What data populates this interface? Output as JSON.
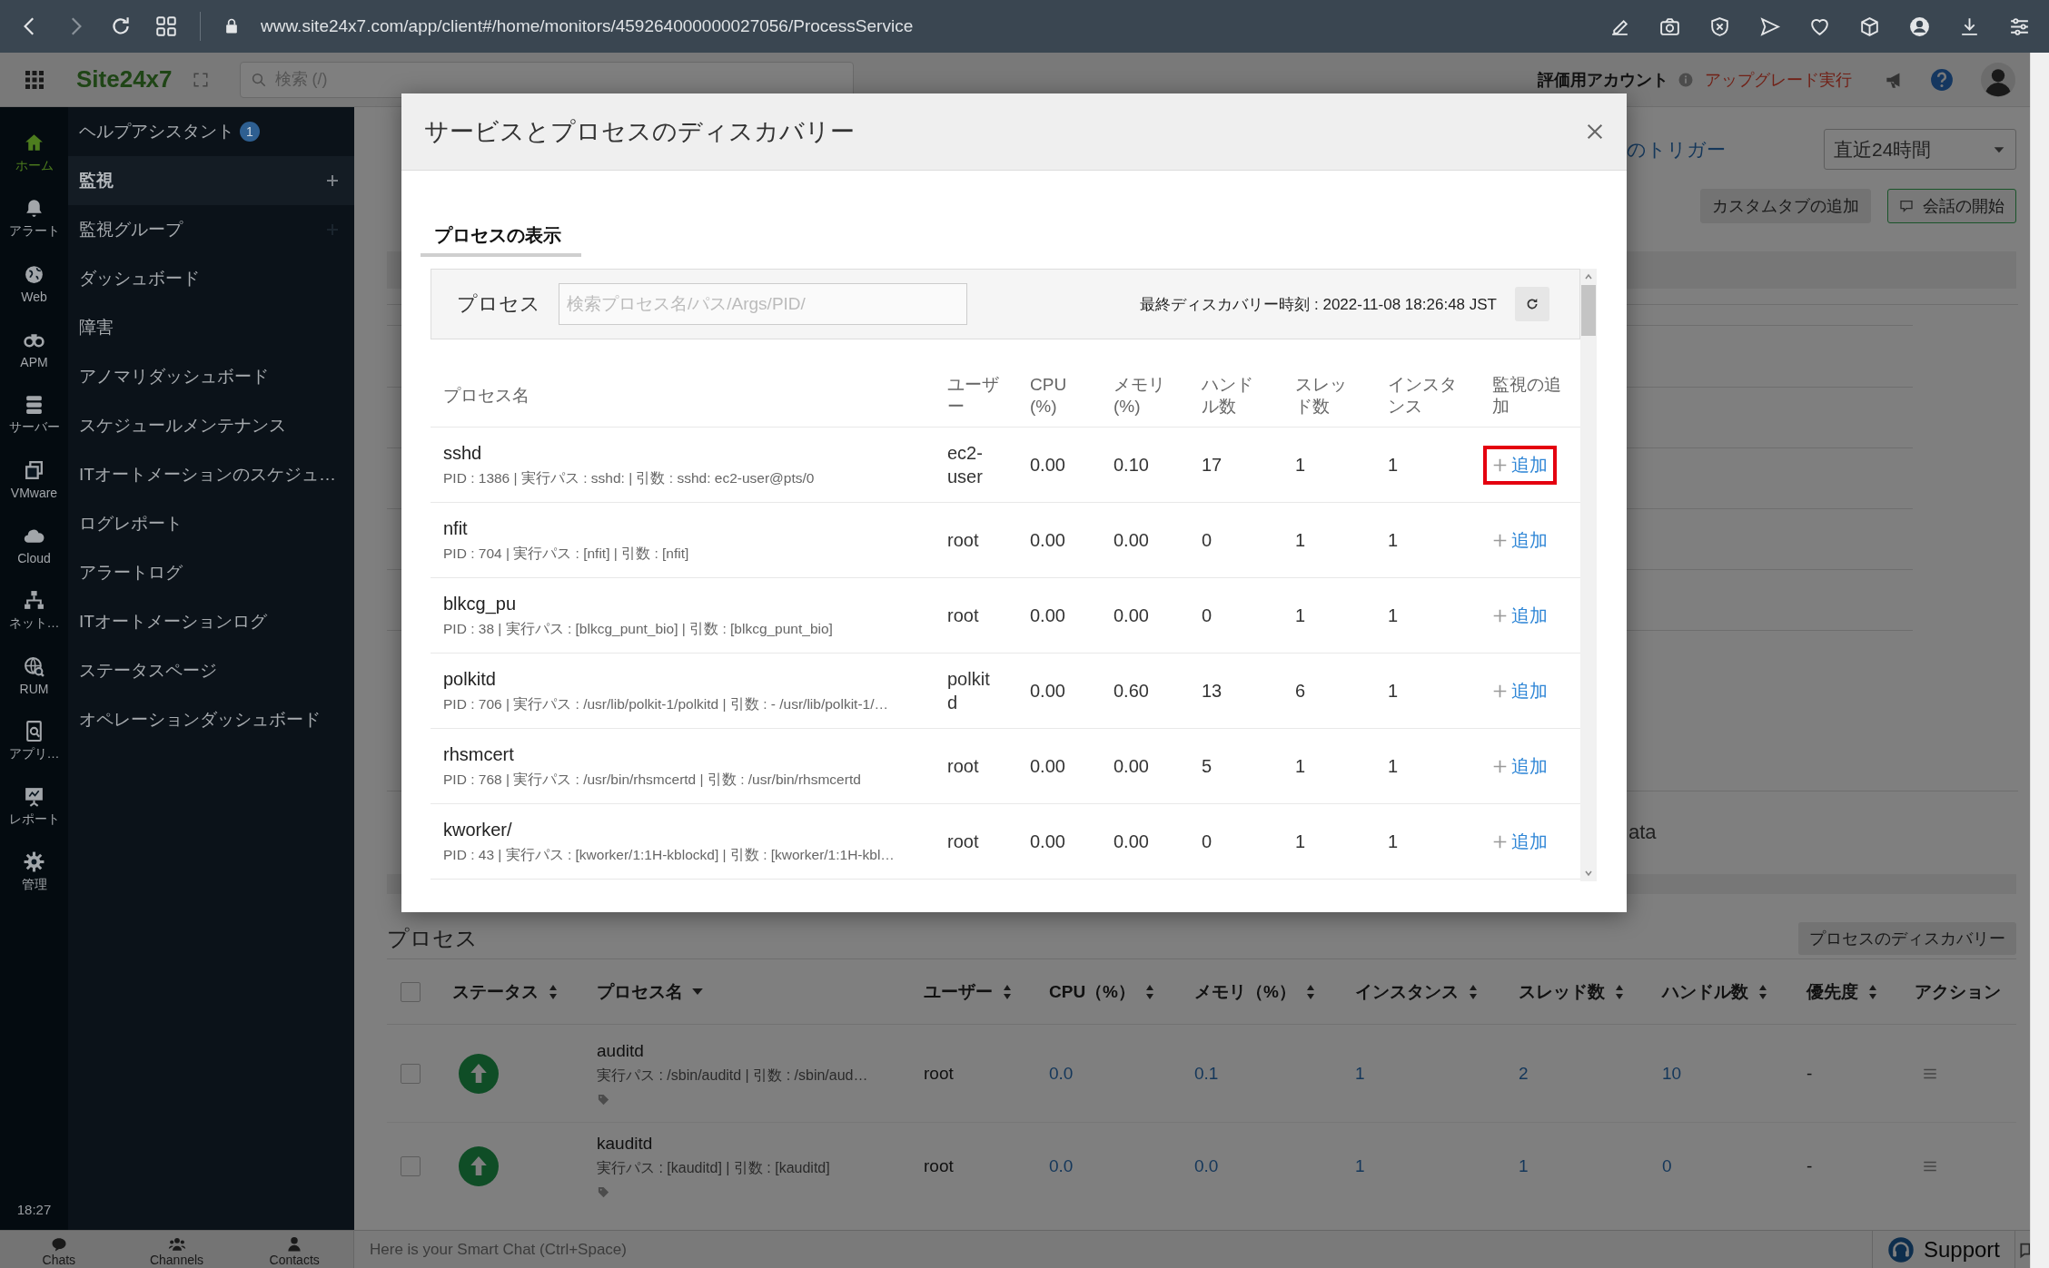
{
  "browser": {
    "url": "www.site24x7.com/app/client#/home/monitors/459264000000027056/ProcessService"
  },
  "header": {
    "logo": "Site24x7",
    "search_placeholder": "検索 (/)",
    "account": "評価用アカウント",
    "upgrade": "アップグレード実行"
  },
  "rail": [
    {
      "label": "ホーム",
      "selected": true
    },
    {
      "label": "アラート",
      "selected": false
    },
    {
      "label": "Web",
      "selected": false
    },
    {
      "label": "APM",
      "selected": false
    },
    {
      "label": "サーバー",
      "selected": false
    },
    {
      "label": "VMware",
      "selected": false
    },
    {
      "label": "Cloud",
      "selected": false
    },
    {
      "label": "ネット…",
      "selected": false
    },
    {
      "label": "RUM",
      "selected": false
    },
    {
      "label": "アプリ…",
      "selected": false
    },
    {
      "label": "レポート",
      "selected": false
    },
    {
      "label": "管理",
      "selected": false
    }
  ],
  "clock": "18:27",
  "nav": [
    {
      "label": "ヘルプアシスタント",
      "badge": "1",
      "selected": false,
      "addable": false
    },
    {
      "label": "監視",
      "selected": true,
      "addable": true
    },
    {
      "label": "監視グループ",
      "selected": false,
      "addable": true
    },
    {
      "label": "ダッシュボード",
      "selected": false,
      "addable": false
    },
    {
      "label": "障害",
      "selected": false,
      "addable": false
    },
    {
      "label": "アノマリダッシュボード",
      "selected": false,
      "addable": false
    },
    {
      "label": "スケジュールメンテナンス",
      "selected": false,
      "addable": false
    },
    {
      "label": "ITオートメーションのスケジュ…",
      "selected": false,
      "addable": false
    },
    {
      "label": "ログレポート",
      "selected": false,
      "addable": false
    },
    {
      "label": "アラートログ",
      "selected": false,
      "addable": false
    },
    {
      "label": "ITオートメーションログ",
      "selected": false,
      "addable": false
    },
    {
      "label": "ステータスページ",
      "selected": false,
      "addable": false
    },
    {
      "label": "オペレーションダッシュボード",
      "selected": false,
      "addable": false
    }
  ],
  "chat_bar": {
    "tabs": [
      "Chats",
      "Channels",
      "Contacts"
    ],
    "prompt": "Here is your Smart Chat (Ctrl+Space)",
    "support": "Support"
  },
  "main": {
    "trigger_link": "のトリガー",
    "range": "直近24時間",
    "buttons": [
      "カスタムタブの追加",
      "会話の開始"
    ],
    "fragment": "ata",
    "process_title": "プロセス",
    "discover_button": "プロセスのディスカバリー",
    "select_all_checked": false,
    "columns": [
      {
        "label": "ステータス",
        "sortable": true
      },
      {
        "label": "プロセス名",
        "sortable": true,
        "sorted": true
      },
      {
        "label": "ユーザー",
        "sortable": true
      },
      {
        "label": "CPU（%）",
        "sortable": true
      },
      {
        "label": "メモリ（%）",
        "sortable": true
      },
      {
        "label": "インスタンス",
        "sortable": true
      },
      {
        "label": "スレッド数",
        "sortable": true
      },
      {
        "label": "ハンドル数",
        "sortable": true
      },
      {
        "label": "優先度",
        "sortable": true
      },
      {
        "label": "アクション",
        "sortable": false
      }
    ],
    "rows": [
      {
        "up": true,
        "name": "auditd",
        "detail": "実行パス : /sbin/auditd | 引数 : /sbin/aud…",
        "user": "root",
        "cpu": "0.0",
        "memory": "0.1",
        "instances": "1",
        "threads": "2",
        "handles": "10",
        "priority": "-",
        "checked": false
      },
      {
        "up": true,
        "name": "kauditd",
        "detail": "実行パス : [kauditd] | 引数 : [kauditd]",
        "user": "root",
        "cpu": "0.0",
        "memory": "0.0",
        "instances": "1",
        "threads": "1",
        "handles": "0",
        "priority": "-",
        "checked": false
      }
    ]
  },
  "dialog": {
    "title": "サービスとプロセスのディスカバリー",
    "tabs": [
      {
        "label": "プロセスの表示",
        "selected": true
      }
    ],
    "search_label": "プロセス",
    "search_placeholder": "検索プロセス名/パス/Args/PID/",
    "last_discovery": "最終ディスカバリー時刻 : 2022-11-08 18:26:48 JST",
    "columns": [
      "プロセス名",
      "ユーザー",
      "CPU (%)",
      "メモリ (%)",
      "ハンドル数",
      "スレッド数",
      "インスタンス",
      "監視の追加"
    ],
    "rows": [
      {
        "name": "sshd",
        "detail": "PID : 1386 | 実行パス : sshd: | 引数 : sshd: ec2-user@pts/0",
        "user": "ec2-user",
        "cpu": "0.00",
        "memory": "0.10",
        "handles": "17",
        "threads": "1",
        "instances": "1",
        "action": "追加",
        "highlighted": true
      },
      {
        "name": "nfit",
        "detail": "PID : 704 | 実行パス : [nfit] | 引数 : [nfit]",
        "user": "root",
        "cpu": "0.00",
        "memory": "0.00",
        "handles": "0",
        "threads": "1",
        "instances": "1",
        "action": "追加",
        "highlighted": false
      },
      {
        "name": "blkcg_pu",
        "detail": "PID : 38 | 実行パス : [blkcg_punt_bio] | 引数 : [blkcg_punt_bio]",
        "user": "root",
        "cpu": "0.00",
        "memory": "0.00",
        "handles": "0",
        "threads": "1",
        "instances": "1",
        "action": "追加",
        "highlighted": false
      },
      {
        "name": "polkitd",
        "detail": "PID : 706 | 実行パス : /usr/lib/polkit-1/polkitd | 引数 : - /usr/lib/polkit-1/…",
        "user": "polkitd",
        "cpu": "0.00",
        "memory": "0.60",
        "handles": "13",
        "threads": "6",
        "instances": "1",
        "action": "追加",
        "highlighted": false
      },
      {
        "name": "rhsmcert",
        "detail": "PID : 768 | 実行パス : /usr/bin/rhsmcertd | 引数 : /usr/bin/rhsmcertd",
        "user": "root",
        "cpu": "0.00",
        "memory": "0.00",
        "handles": "5",
        "threads": "1",
        "instances": "1",
        "action": "追加",
        "highlighted": false
      },
      {
        "name": "kworker/",
        "detail": "PID : 43 | 実行パス : [kworker/1:1H-kblockd] | 引数 : [kworker/1:1H-kbl…",
        "user": "root",
        "cpu": "0.00",
        "memory": "0.00",
        "handles": "0",
        "threads": "1",
        "instances": "1",
        "action": "追加",
        "highlighted": false
      }
    ]
  }
}
